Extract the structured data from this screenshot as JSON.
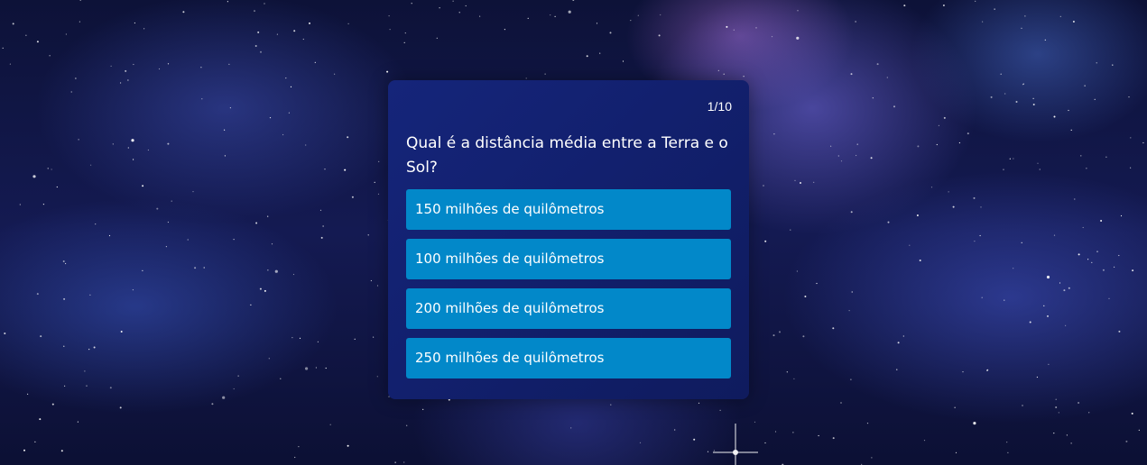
{
  "quiz": {
    "counter": "1/10",
    "question": "Qual é a distância média entre a Terra e o Sol?",
    "options": [
      "150 milhões de quilômetros",
      "100 milhões de quilômetros",
      "200 milhões de quilômetros",
      "250 milhões de quilômetros"
    ]
  }
}
